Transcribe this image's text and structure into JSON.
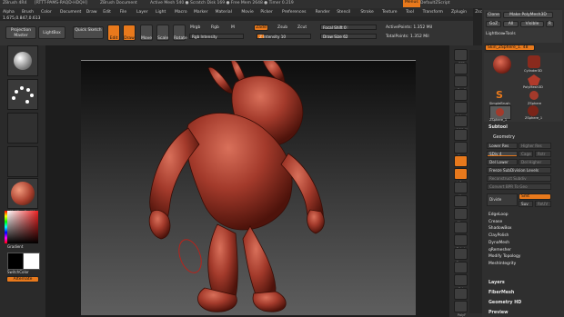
{
  "titlebar": {
    "app": "ZBrush 4R4",
    "info": "[RTTT-PAMS-RAQD-HDQH]",
    "document": "ZBrush Document",
    "active_mesh": "Active Mesh 540 ● Scratch Disk 169 ● Free Mem 2648 ● Timer 0.219",
    "menus": "Menus",
    "default_zscript": "DefaultZScript"
  },
  "menu": [
    "Alpha",
    "Brush",
    "Color",
    "Document",
    "Draw",
    "Edit",
    "File",
    "Layer",
    "Light",
    "Macro",
    "Marker",
    "Material",
    "Movie",
    "Picker",
    "Preferences",
    "Render",
    "Stencil",
    "Stroke",
    "Texture",
    "Tool",
    "Transform",
    "Zplugin",
    "Zscript"
  ],
  "brush_coords": "1.675,0.847,0.613",
  "toolbar": {
    "projection_master": "Projection Master",
    "lightbox": "LightBox",
    "quick_sketch": "Quick Sketch",
    "edit": "Edit",
    "draw": "Draw",
    "move": "Move",
    "scale": "Scale",
    "rotate": "Rotate",
    "mrgb": "Mrgb",
    "rgb": "Rgb",
    "m": "M",
    "rgb_intensity": "Rgb Intensity",
    "zadd": "Zadd",
    "zsub": "Zsub",
    "zcut": "Zcut",
    "z_intensity": "Z Intensity 10",
    "focal_shift": "Focal Shift 0",
    "draw_size": "Draw Size 62",
    "active_points": "ActivePoints: 1.352 Mil",
    "total_points": "TotalPoints: 1.352 Mil"
  },
  "left_panel": {
    "materials_caption": "MatCap Red01",
    "gradient": "Gradient",
    "switch_color": "SwitchColor",
    "alternate": "Alternate"
  },
  "right_shelf": [
    "BPR",
    "SPix",
    "Scroll",
    "Zoom",
    "Actual",
    "AAHalf",
    "Persp",
    "Floor",
    "Local",
    "L.Sym",
    "Xyz",
    "Frame",
    "Move",
    "Scale",
    "Rotate",
    "Transp",
    "Ghost",
    "Solo",
    "Xpose",
    "PolyF"
  ],
  "tray": {
    "top_buttons": [
      "Clone",
      "Make PolyMesh3D",
      "GoZ",
      "All",
      "Visible",
      "R"
    ],
    "lightbox_tools": "Lightbox▸Tools",
    "current_tool": "Skin_ZSphere_1. 48",
    "tool_thumbs": [
      "Cylinder3D",
      "PolyMesh3D",
      "SimpleBrush",
      "ZSphere",
      "ZSphere_1"
    ],
    "subtool": "Subtool",
    "geometry": "Geometry",
    "lower_res": "Lower Res",
    "higher_res": "Higher Res",
    "sdiv": "SDiv 4",
    "cage": "Cage",
    "rstr": "Rstr",
    "del_lower": "Del Lower",
    "del_higher": "Del Higher",
    "freeze": "Freeze SubDivision Levels",
    "reconstruct": "Reconstruct Subdiv",
    "convert_bpr": "Convert BPR To Geo",
    "divide": "Divide",
    "smt": "Smt",
    "suv": "Suv",
    "reuv": "ReUV",
    "sections": [
      "EdgeLoop",
      "Crease",
      "ShadowBox",
      "ClayPolish",
      "DynaMesh",
      "qRemesher",
      "Modify Topology",
      "MeshIntegrity"
    ],
    "bottom_sections": [
      "Layers",
      "FiberMesh",
      "Geometry HD",
      "Preview"
    ]
  },
  "colors": {
    "accent": "#e8791c",
    "clay": "#9e3a2e"
  }
}
